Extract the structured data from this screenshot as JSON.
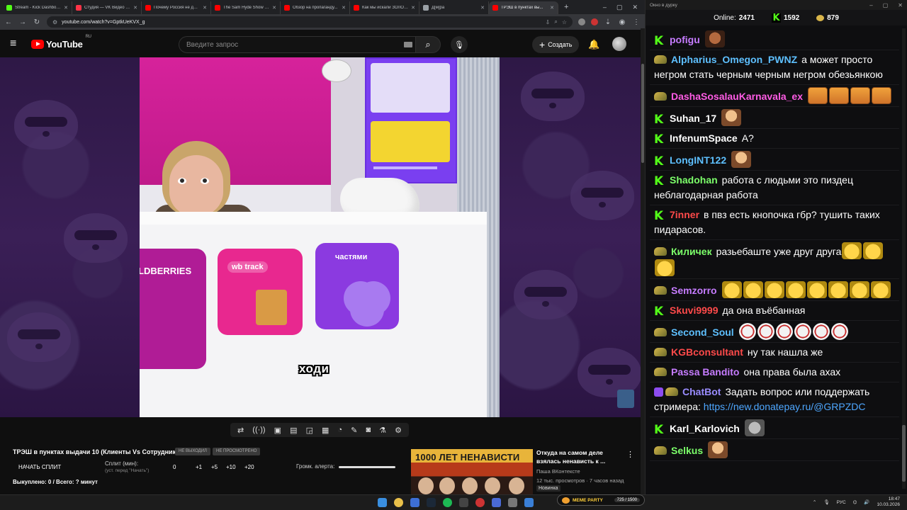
{
  "browser": {
    "tabs": [
      {
        "title": "Stream - Kick Dashboard",
        "color": "#53fc18",
        "active": false
      },
      {
        "title": "Студия — VK Видео Live",
        "color": "#ff3347",
        "active": false
      },
      {
        "title": "Почему Россия не дает...",
        "color": "#ff0000",
        "active": false
      },
      {
        "title": "The Sam Hyde Show D...",
        "color": "#ff0000",
        "active": false
      },
      {
        "title": "Обзор на пропаганду...",
        "color": "#ff0000",
        "active": false
      },
      {
        "title": "Как мы искали ЗОЛОТ...",
        "color": "#ff0000",
        "active": false
      },
      {
        "title": "Д[м]ра",
        "color": "#9aa0a6",
        "active": false
      },
      {
        "title": "ТРЭШ в пунктах вы...",
        "color": "#ff0000",
        "active": true
      }
    ],
    "url": "youtube.com/watch?v=GptkUeKVX_g"
  },
  "youtube": {
    "logo_text": "YouTube",
    "region": "RU",
    "search_placeholder": "Введите запрос",
    "create_label": "Создать"
  },
  "video": {
    "subtitle": "ходи",
    "scene_texts": {
      "card1": "LDBERRIES",
      "card2": "wb track",
      "card3": "частями"
    }
  },
  "below": {
    "title": "ТРЭШ в пунктах выдачи 10 (Клиенты Vs Сотрудники)",
    "chip1": "НЕ ВЫХОДИЛ",
    "chip2": "НЕ ПРОСМОТРЕНО",
    "start_split": "НАЧАТЬ СПЛИТ",
    "split_label": "Сплит (мин):",
    "split_sub": "(уст. перед \"Начать\")",
    "split_value": "0",
    "increments": [
      "+1",
      "+5",
      "+10",
      "+20"
    ],
    "volume_label": "Громк. алерта:",
    "bought": "Выкуплено: 0 / Всего: ? минут",
    "rec": {
      "thumb_text": "1000 ЛЕТ НЕНАВИСТИ",
      "title": "Откуда на самом деле взялась ненависть к ...",
      "channel": "Паша ВКонтексте",
      "meta": "12 тыс. просмотров · 7 часов назад",
      "badge": "Новинка"
    }
  },
  "chat": {
    "window_title": "Окно в дурку",
    "online_label": "Online:",
    "online_count": "2471",
    "kick_count": "1592",
    "coin_count": "879",
    "messages": [
      {
        "badge": "kick",
        "nick": "pofigu",
        "color": "#c67cff",
        "text": "",
        "emotes": [
          "em-dark"
        ]
      },
      {
        "badge": "ava",
        "nick": "Alpharius_Omegon_PWNZ",
        "color": "#5ec0ff",
        "text": "а может просто негром стать черным черным негром обезьянкою",
        "emotes": []
      },
      {
        "badge": "ava",
        "nick": "DashaSosalauKarnavala_ex",
        "color": "#ff5ce5",
        "text": "",
        "emotes": [
          "em-tiger",
          "em-tiger",
          "em-tiger",
          "em-tiger"
        ]
      },
      {
        "badge": "kick",
        "nick": "Suhan_17",
        "color": "#ffffff",
        "text": "",
        "emotes": [
          "em-face"
        ]
      },
      {
        "badge": "kick",
        "nick": "InfenumSpace",
        "color": "#ffffff",
        "text": "А?",
        "emotes": []
      },
      {
        "badge": "kick",
        "nick": "LongINT122",
        "color": "#5ec0ff",
        "text": "",
        "emotes": [
          "em-face"
        ]
      },
      {
        "badge": "kick",
        "nick": "Shadohan",
        "color": "#7cff6a",
        "text": "работа с людьми это пиздец неблагодарная работа",
        "emotes": []
      },
      {
        "badge": "kick",
        "nick": "7inner",
        "color": "#ff4a4a",
        "text": "в пвз есть кнопочка гбр? тушить таких пидарасов.",
        "emotes": []
      },
      {
        "badge": "ava",
        "nick": "Киличек",
        "color": "#7cff6a",
        "text": "разьебаште уже друг друга",
        "emotes": [
          "em-laugh",
          "em-laugh",
          "em-laugh"
        ]
      },
      {
        "badge": "ava",
        "nick": "Semzorro",
        "color": "#c67cff",
        "text": "",
        "emotes": [
          "em-laugh",
          "em-laugh",
          "em-laugh",
          "em-laugh",
          "em-laugh",
          "em-laugh",
          "em-laugh",
          "em-laugh"
        ]
      },
      {
        "badge": "kick",
        "nick": "Skuvi9999",
        "color": "#ff4a4a",
        "text": "да она въёбанная",
        "emotes": []
      },
      {
        "badge": "ava",
        "nick": "Second_Soul",
        "color": "#5ec0ff",
        "text": "",
        "emotes": [
          "em-red",
          "em-red",
          "em-red",
          "em-red",
          "em-red",
          "em-red"
        ]
      },
      {
        "badge": "ava",
        "nick": "KGBconsultant",
        "color": "#ff4a4a",
        "text": "ну так нашла же",
        "emotes": []
      },
      {
        "badge": "ava",
        "nick": "Passa Bandito",
        "color": "#c67cff",
        "text": "она права была ахах",
        "emotes": []
      },
      {
        "badge": "bot",
        "nick": "ChatBot",
        "color": "#9a8cff",
        "text": "Задать вопрос или поддержать стримера:",
        "link": "https://new.donatepay.ru/@GRPZDC",
        "emotes": []
      },
      {
        "badge": "kick",
        "nick": "Karl_Karlovich",
        "color": "#ffffff",
        "text": "",
        "emotes": [
          "em-grey"
        ]
      },
      {
        "badge": "ava",
        "nick": "Selkus",
        "color": "#7cff6a",
        "text": "",
        "emotes": [
          "em-face"
        ]
      }
    ]
  },
  "taskbar": {
    "meme_title": "MEME PARTY",
    "meme_count": "725 / 1500",
    "lang": "РУС",
    "time": "18:47",
    "date": "10.03.2026"
  }
}
